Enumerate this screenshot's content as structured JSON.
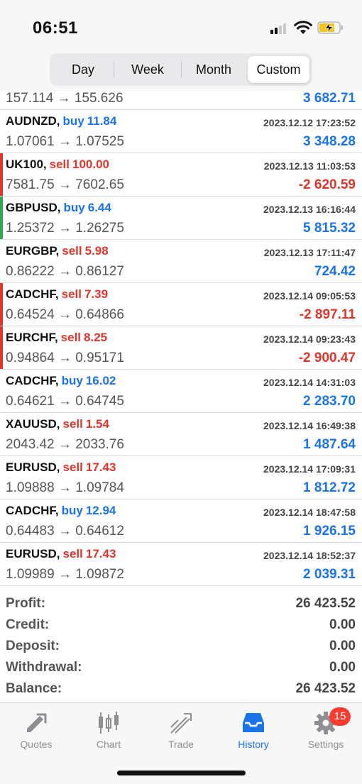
{
  "status": {
    "time": "06:51"
  },
  "segmented": {
    "day": "Day",
    "week": "Week",
    "month": "Month",
    "custom": "Custom"
  },
  "partial_row": {
    "prices": "157.114 → 155.626",
    "profit": "3 682.71"
  },
  "trades": [
    {
      "symbol": "AUDNZD,",
      "side": "buy",
      "volume": "11.84",
      "datetime": "2023.12.12 17:23:52",
      "prices": "1.07061 → 1.07525",
      "profit": "3 348.28",
      "profit_sign": "pos",
      "marker": ""
    },
    {
      "symbol": "UK100,",
      "side": "sell",
      "volume": "100.00",
      "datetime": "2023.12.13 11:03:53",
      "prices": "7581.75 → 7602.65",
      "profit": "-2 620.59",
      "profit_sign": "neg",
      "marker": "#e0352b"
    },
    {
      "symbol": "GBPUSD,",
      "side": "buy",
      "volume": "6.44",
      "datetime": "2023.12.13 16:16:44",
      "prices": "1.25372 → 1.26275",
      "profit": "5 815.32",
      "profit_sign": "pos",
      "marker": "#2ca84a"
    },
    {
      "symbol": "EURGBP,",
      "side": "sell",
      "volume": "5.98",
      "datetime": "2023.12.13 17:11:47",
      "prices": "0.86222 → 0.86127",
      "profit": "724.42",
      "profit_sign": "pos",
      "marker": ""
    },
    {
      "symbol": "CADCHF,",
      "side": "sell",
      "volume": "7.39",
      "datetime": "2023.12.14 09:05:53",
      "prices": "0.64524 → 0.64866",
      "profit": "-2 897.11",
      "profit_sign": "neg",
      "marker": "#e0352b"
    },
    {
      "symbol": "EURCHF,",
      "side": "sell",
      "volume": "8.25",
      "datetime": "2023.12.14 09:23:43",
      "prices": "0.94864 → 0.95171",
      "profit": "-2 900.47",
      "profit_sign": "neg",
      "marker": "#e0352b"
    },
    {
      "symbol": "CADCHF,",
      "side": "buy",
      "volume": "16.02",
      "datetime": "2023.12.14 14:31:03",
      "prices": "0.64621 → 0.64745",
      "profit": "2 283.70",
      "profit_sign": "pos",
      "marker": ""
    },
    {
      "symbol": "XAUUSD,",
      "side": "sell",
      "volume": "1.54",
      "datetime": "2023.12.14 16:49:38",
      "prices": "2043.42 → 2033.76",
      "profit": "1 487.64",
      "profit_sign": "pos",
      "marker": ""
    },
    {
      "symbol": "EURUSD,",
      "side": "sell",
      "volume": "17.43",
      "datetime": "2023.12.14 17:09:31",
      "prices": "1.09888 → 1.09784",
      "profit": "1 812.72",
      "profit_sign": "pos",
      "marker": ""
    },
    {
      "symbol": "CADCHF,",
      "side": "buy",
      "volume": "12.94",
      "datetime": "2023.12.14 18:47:58",
      "prices": "0.64483 → 0.64612",
      "profit": "1 926.15",
      "profit_sign": "pos",
      "marker": ""
    },
    {
      "symbol": "EURUSD,",
      "side": "sell",
      "volume": "17.43",
      "datetime": "2023.12.14 18:52:37",
      "prices": "1.09989 → 1.09872",
      "profit": "2 039.31",
      "profit_sign": "pos",
      "marker": ""
    }
  ],
  "summary": {
    "profit_label": "Profit:",
    "profit": "26 423.52",
    "credit_label": "Credit:",
    "credit": "0.00",
    "deposit_label": "Deposit:",
    "deposit": "0.00",
    "withdrawal_label": "Withdrawal:",
    "withdrawal": "0.00",
    "balance_label": "Balance:",
    "balance": "26 423.52"
  },
  "tabs": {
    "quotes": "Quotes",
    "chart": "Chart",
    "trade": "Trade",
    "history": "History",
    "settings": "Settings",
    "settings_badge": "15"
  },
  "colors": {
    "accent": "#1a73e8",
    "loss": "#e0352b",
    "gain_marker": "#2ca84a"
  }
}
